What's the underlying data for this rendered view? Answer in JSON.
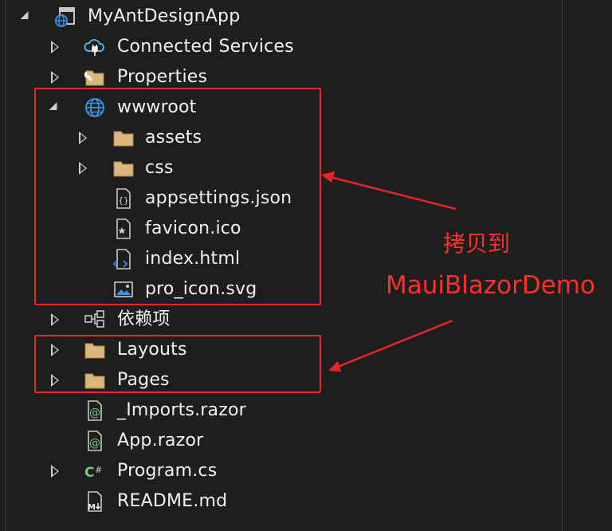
{
  "tree": {
    "project": "MyAntDesignApp",
    "items": [
      {
        "label": "Connected Services",
        "icon": "connected-services-icon"
      },
      {
        "label": "Properties",
        "icon": "properties-folder-icon"
      },
      {
        "label": "wwwroot",
        "icon": "globe-icon"
      },
      {
        "label": "assets",
        "icon": "folder-icon"
      },
      {
        "label": "css",
        "icon": "folder-icon"
      },
      {
        "label": "appsettings.json",
        "icon": "json-file-icon"
      },
      {
        "label": "favicon.ico",
        "icon": "ico-file-icon"
      },
      {
        "label": "index.html",
        "icon": "html-file-icon"
      },
      {
        "label": "pro_icon.svg",
        "icon": "image-file-icon"
      },
      {
        "label": "依赖项",
        "icon": "dependencies-icon"
      },
      {
        "label": "Layouts",
        "icon": "folder-icon"
      },
      {
        "label": "Pages",
        "icon": "folder-icon"
      },
      {
        "label": "_Imports.razor",
        "icon": "razor-file-icon"
      },
      {
        "label": "App.razor",
        "icon": "razor-file-icon"
      },
      {
        "label": "Program.cs",
        "icon": "csharp-file-icon"
      },
      {
        "label": "README.md",
        "icon": "markdown-file-icon"
      }
    ]
  },
  "annotation": {
    "line1": "拷贝到",
    "line2": "MauiBlazorDemo",
    "color": "#ff2d2d"
  }
}
